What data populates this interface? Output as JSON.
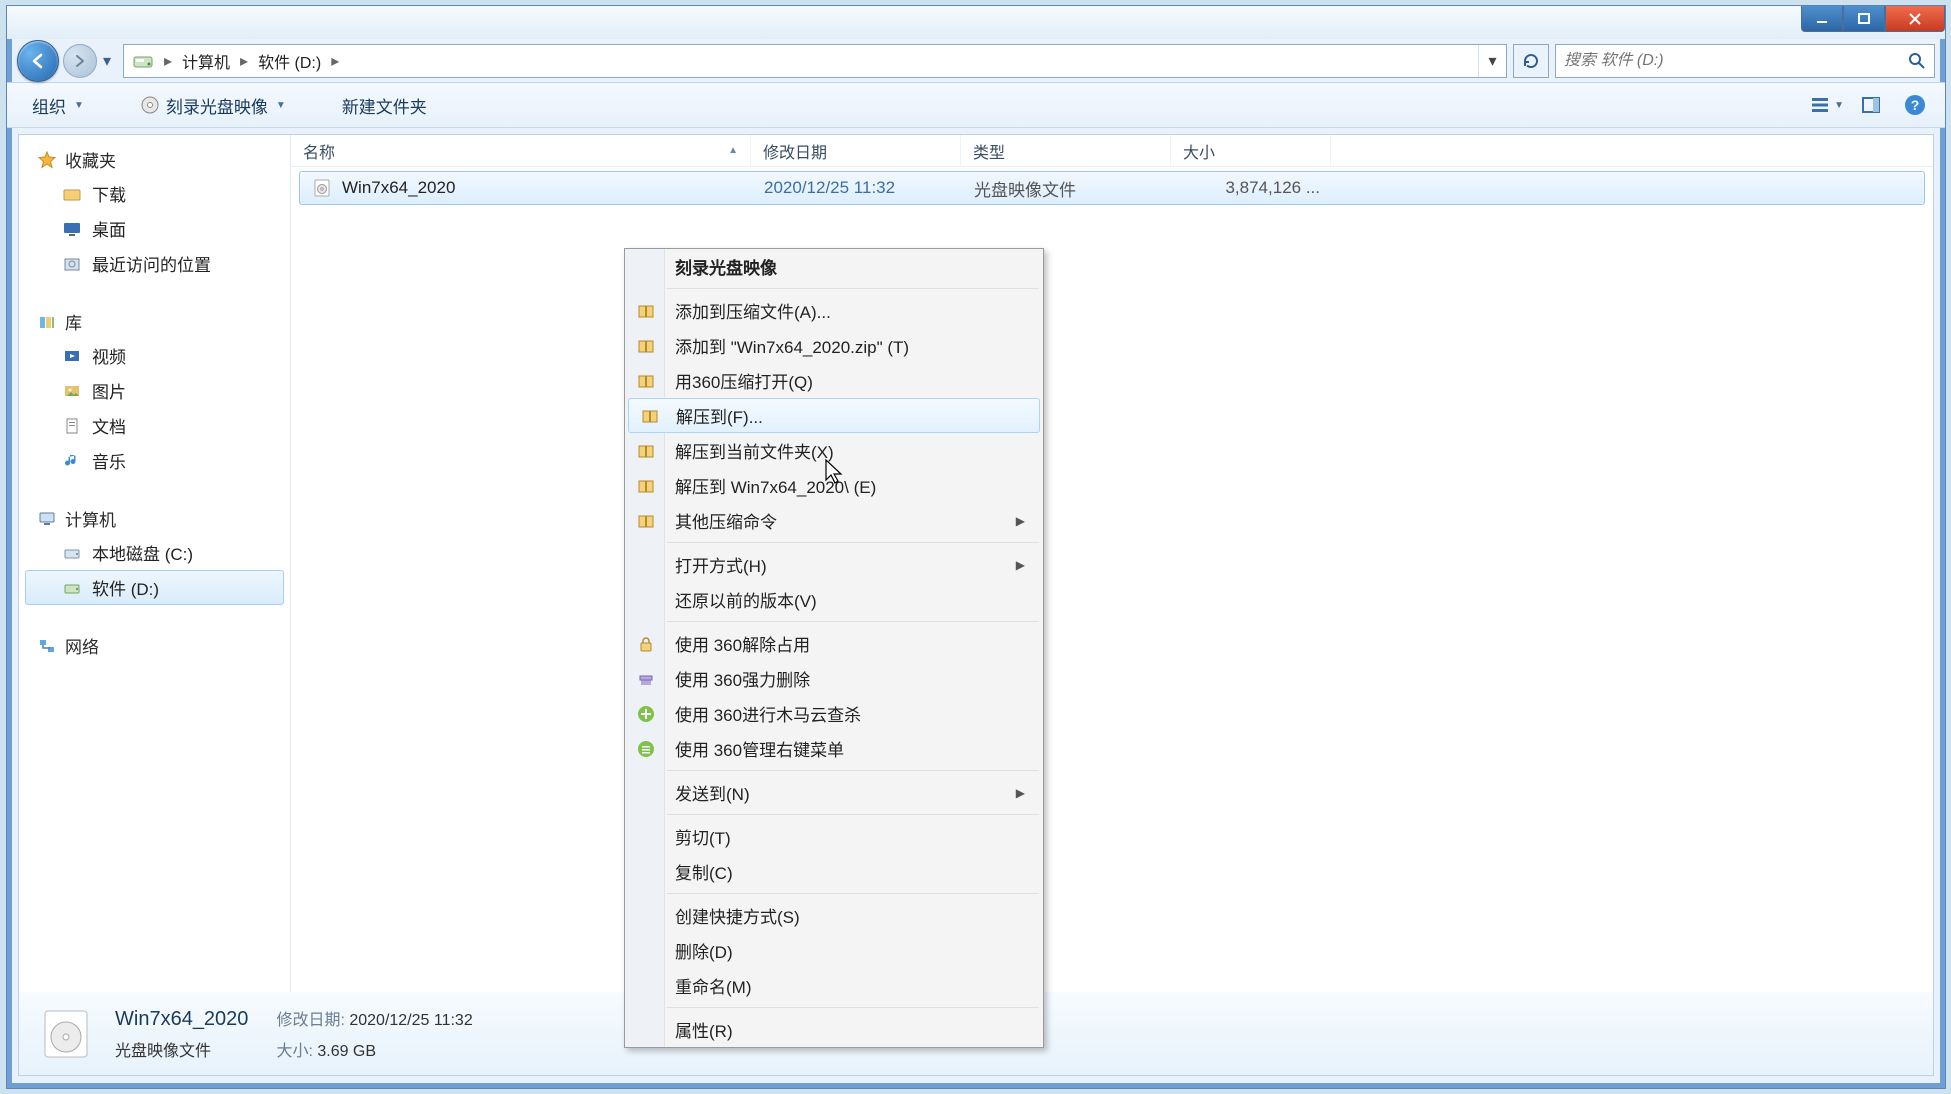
{
  "breadcrumb": {
    "seg1": "计算机",
    "seg2": "软件 (D:)"
  },
  "search": {
    "placeholder": "搜索 软件 (D:)"
  },
  "toolbar": {
    "organize": "组织",
    "burn": "刻录光盘映像",
    "newfolder": "新建文件夹"
  },
  "sidebar": {
    "favorites": {
      "label": "收藏夹",
      "items": [
        "下载",
        "桌面",
        "最近访问的位置"
      ]
    },
    "libraries": {
      "label": "库",
      "items": [
        "视频",
        "图片",
        "文档",
        "音乐"
      ]
    },
    "computer": {
      "label": "计算机",
      "items": [
        "本地磁盘 (C:)",
        "软件 (D:)"
      ]
    },
    "network": {
      "label": "网络"
    }
  },
  "columns": {
    "name": "名称",
    "date": "修改日期",
    "type": "类型",
    "size": "大小"
  },
  "file": {
    "name": "Win7x64_2020",
    "date": "2020/12/25 11:32",
    "type": "光盘映像文件",
    "size": "3,874,126 ..."
  },
  "context": {
    "burn": "刻录光盘映像",
    "add_archive": "添加到压缩文件(A)...",
    "add_zip": "添加到 \"Win7x64_2020.zip\" (T)",
    "open_360zip": "用360压缩打开(Q)",
    "extract_to": "解压到(F)...",
    "extract_here": "解压到当前文件夹(X)",
    "extract_named": "解压到 Win7x64_2020\\ (E)",
    "other_zip": "其他压缩命令",
    "open_with": "打开方式(H)",
    "restore_prev": "还原以前的版本(V)",
    "unlock_360": "使用 360解除占用",
    "force_del_360": "使用 360强力删除",
    "cloud_scan_360": "使用 360进行木马云查杀",
    "manage_ctx_360": "使用 360管理右键菜单",
    "send_to": "发送到(N)",
    "cut": "剪切(T)",
    "copy": "复制(C)",
    "shortcut": "创建快捷方式(S)",
    "delete": "删除(D)",
    "rename": "重命名(M)",
    "properties": "属性(R)"
  },
  "details": {
    "title": "Win7x64_2020",
    "type": "光盘映像文件",
    "date_label": "修改日期:",
    "date": "2020/12/25 11:32",
    "size_label": "大小:",
    "size": "3.69 GB"
  }
}
